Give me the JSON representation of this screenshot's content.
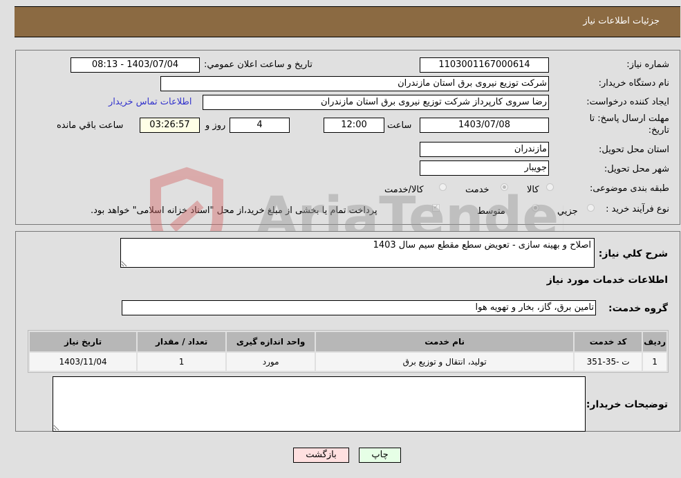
{
  "header": {
    "title": "جزئیات اطلاعات نیاز"
  },
  "details": {
    "need_number_label": "شماره نیاز:",
    "need_number": "1103001167000614",
    "announce_label": "تاریخ و ساعت اعلان عمومي:",
    "announce_value": "1403/07/04 - 08:13",
    "buyer_org_label": "نام دستگاه خریدار:",
    "buyer_org": "شرکت توزیع نیروی برق استان مازندران",
    "creator_label": "ایجاد کننده درخواست:",
    "creator": "رضا سروی کارپرداز شرکت توزیع نیروی برق استان مازندران",
    "contact_link": "اطلاعات تماس خریدار",
    "deadline_label_line1": "مهلت ارسال پاسخ: تا",
    "deadline_label_line2": "تاریخ:",
    "deadline_date": "1403/07/08",
    "time_label": "ساعت",
    "deadline_time": "12:00",
    "days_value": "4",
    "days_label": "روز و",
    "remaining_time": "03:26:57",
    "remaining_label": "ساعت باقي مانده",
    "province_label": "استان محل تحویل:",
    "province": "مازندران",
    "city_label": "شهر محل تحویل:",
    "city": "جویبار",
    "category_label": "طبقه بندی موضوعی:",
    "category_options": [
      {
        "label": "کالا",
        "checked": false
      },
      {
        "label": "خدمت",
        "checked": true
      },
      {
        "label": "کالا/خدمت",
        "checked": false
      }
    ],
    "process_label": "نوع فرآیند خرید :",
    "process_options": [
      {
        "label": "جزيي",
        "checked": false
      },
      {
        "label": "متوسط",
        "checked": true
      }
    ],
    "treasury_checked": true,
    "treasury_text": "پرداخت تمام یا بخشی از مبلغ خرید،از محل \"اسناد خزانه اسلامی\" خواهد بود."
  },
  "summary": {
    "label": "شرح کلي نیاز:",
    "value": "اصلاح و بهینه سازی - تعویض سطع مقطع سیم سال 1403"
  },
  "services": {
    "section_title": "اطلاعات خدمات مورد نیاز",
    "group_label": "گروه خدمت:",
    "group_value": "تامین برق، گاز، بخار و تهویه هوا",
    "columns": [
      "ردیف",
      "کد خدمت",
      "نام خدمت",
      "واحد اندازه گیری",
      "تعداد / مقدار",
      "تاریخ نیاز"
    ],
    "rows": [
      [
        "1",
        "ت -35-351",
        "تولید، انتقال و توزیع برق",
        "مورد",
        "1",
        "1403/11/04"
      ]
    ]
  },
  "buyer_notes": {
    "label": "توضیحات خریدار:",
    "value": ""
  },
  "buttons": {
    "print": "چاپ",
    "back": "بازگشت"
  },
  "watermark": {
    "text": "AriaTender.neT"
  },
  "colors": {
    "header_bg": "#8b6a42",
    "link": "#3333cc",
    "print_bg": "#e6ffe6",
    "back_bg": "#ffe0e0"
  }
}
